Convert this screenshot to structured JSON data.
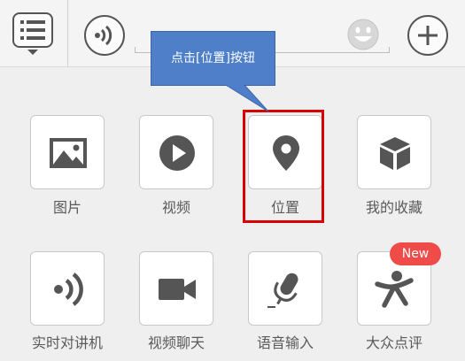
{
  "tooltip": {
    "text": "点击[位置]按钮"
  },
  "toolbar": {
    "icons": [
      "menu-icon",
      "voice-icon",
      "emoji-icon",
      "plus-icon"
    ]
  },
  "panel": {
    "items": [
      {
        "label": "图片",
        "icon": "image-icon"
      },
      {
        "label": "视频",
        "icon": "play-icon"
      },
      {
        "label": "位置",
        "icon": "location-icon"
      },
      {
        "label": "我的收藏",
        "icon": "box-icon"
      },
      {
        "label": "实时对讲机",
        "icon": "walkie-talkie-icon"
      },
      {
        "label": "视频聊天",
        "icon": "video-camera-icon"
      },
      {
        "label": "语音输入",
        "icon": "microphone-icon"
      },
      {
        "label": "大众点评",
        "icon": "dianping-icon"
      }
    ],
    "badge": "New"
  },
  "colors": {
    "highlight": "#d90000",
    "tooltip": "#4e7fc8",
    "badge": "#ef4b48",
    "icon": "#555555"
  }
}
